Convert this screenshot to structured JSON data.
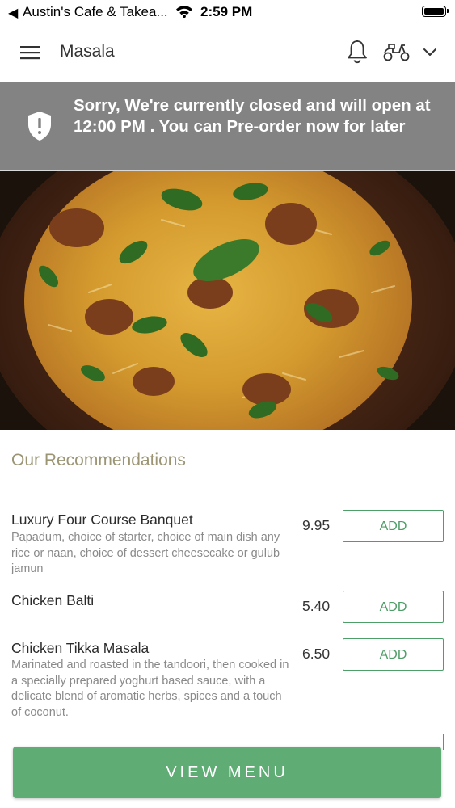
{
  "status_bar": {
    "back_glyph": "◀",
    "carrier": "Austin's Cafe & Takea...",
    "time": "2:59 PM"
  },
  "header": {
    "title": "Masala",
    "icons": [
      "menu-icon",
      "bell-icon",
      "scooter-icon",
      "chevron-down-icon"
    ]
  },
  "banner": {
    "message": "Sorry, We're currently closed and will open at 12:00 PM . You can Pre-order now for later",
    "icon": "shield-alert-icon",
    "background": "#838383"
  },
  "hero": {
    "image": "biryani-dish-photo"
  },
  "recommendations": {
    "title": "Our Recommendations",
    "items": [
      {
        "name": "Luxury Four Course Banquet",
        "description": "Papadum, choice of starter, choice of main dish any rice or naan, choice of dessert cheesecake or gulub jamun",
        "price": "9.95",
        "add_label": "ADD"
      },
      {
        "name": "Chicken Balti",
        "description": "",
        "price": "5.40",
        "add_label": "ADD"
      },
      {
        "name": "Chicken Tikka Masala",
        "description": "Marinated and roasted in the tandoori, then cooked in a specially prepared yoghurt based sauce, with a delicate blend of aromatic herbs, spices and a touch of coconut.",
        "price": "6.50",
        "add_label": "ADD"
      }
    ]
  },
  "footer": {
    "view_menu_label": "VIEW MENU",
    "accent": "#5fac75"
  }
}
